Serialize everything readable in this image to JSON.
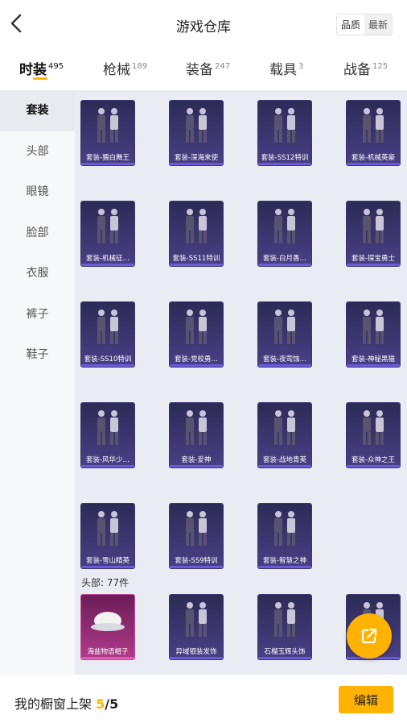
{
  "header": {
    "title": "游戏仓库",
    "sort_options": [
      "品质",
      "最新"
    ]
  },
  "tabs": [
    {
      "label": "时装",
      "count": "495"
    },
    {
      "label": "枪械",
      "count": "189"
    },
    {
      "label": "装备",
      "count": "247"
    },
    {
      "label": "载具",
      "count": "3"
    },
    {
      "label": "战备",
      "count": "125"
    }
  ],
  "sidebar": {
    "items": [
      "套装",
      "头部",
      "眼镜",
      "脸部",
      "衣服",
      "裤子",
      "鞋子"
    ]
  },
  "sets": [
    "套装-猥白舞王",
    "套装-深海来使",
    "套装-SS12特训",
    "套装-机械英豪",
    "套装-机械征…",
    "套装-SS11特训",
    "套装-白月香…",
    "套装-探宝勇士",
    "套装-SS10特训",
    "套装-党校勇…",
    "套装-夜莺蚀…",
    "套装-神秘黑猫",
    "套装-风华少…",
    "套装-爱神",
    "套装-战地青英",
    "套装-众神之王",
    "套装-雪山精英",
    "套装-SS9特训",
    "套装-智慧之神"
  ],
  "head_section": {
    "label": "头部: 77件",
    "items": [
      "海盐物语帽子",
      "异域银装发饰",
      "石榴玉辉头饰",
      "…饰"
    ]
  },
  "footer": {
    "text": "我的橱窗上架",
    "count": "5",
    "total": "/5",
    "edit": "编辑"
  },
  "colors": {
    "accent": "#ffb300",
    "card": "#3b3570"
  },
  "icons": {
    "back": "chevron-left-icon",
    "fab": "share-external-icon"
  }
}
